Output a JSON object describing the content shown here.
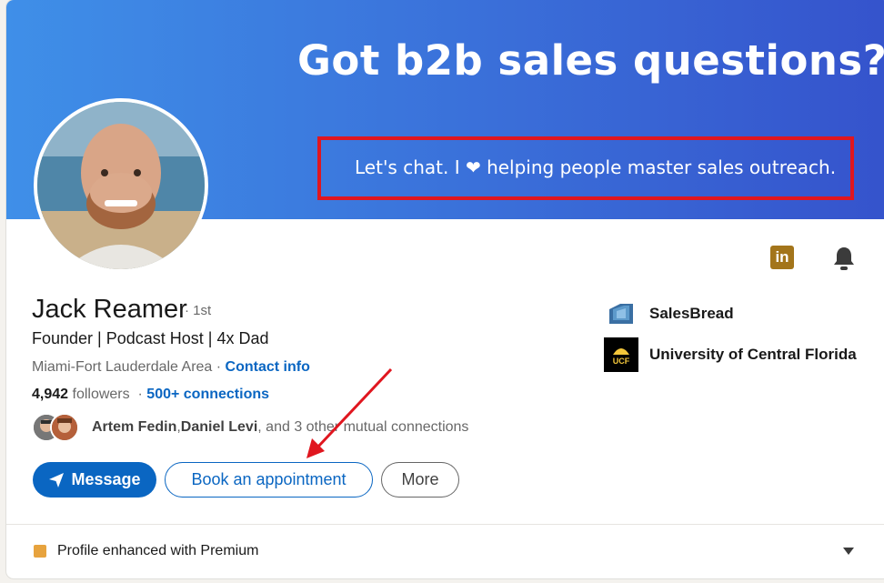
{
  "banner": {
    "headline": "Got b2b sales questions?",
    "subtext": "Let's chat. I ❤ helping people master sales outreach."
  },
  "profile": {
    "name": "Jack Reamer",
    "degree": "· 1st",
    "headline": "Founder | Podcast Host | 4x Dad",
    "location": "Miami-Fort Lauderdale Area",
    "location_sep": " · ",
    "contact_info": "Contact info",
    "followers_count": "4,942",
    "followers_label": " followers",
    "stats_sep": "  · ",
    "connections": "500+ connections"
  },
  "mutual": {
    "name1": "Artem Fedin",
    "sep": ", ",
    "name2": "Daniel Levi",
    "rest": ", and 3 other mutual connections"
  },
  "actions": {
    "message": "Message",
    "book": "Book an appointment",
    "more": "More"
  },
  "sidebar": {
    "company": "SalesBread",
    "school": "University of Central Florida",
    "ucf_logo_text": "UCF"
  },
  "top_icons": {
    "linkedin": "in"
  },
  "premium": {
    "label": "Profile enhanced with Premium"
  },
  "colors": {
    "accent": "#0a66c2",
    "highlight_box": "#e0161f",
    "premium": "#e7a33e"
  }
}
